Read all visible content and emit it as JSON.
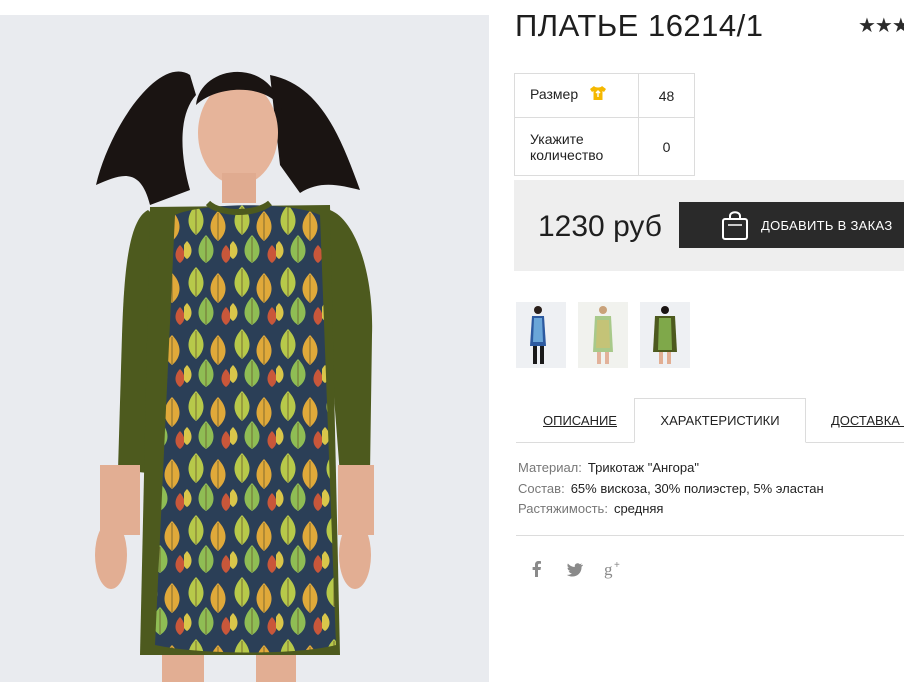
{
  "product": {
    "title": "ПЛАТЬЕ 16214/1",
    "rating_stars": "★★★"
  },
  "options": {
    "size_label": "Размер",
    "size_value": "48",
    "qty_label_line1": "Укажите",
    "qty_label_line2": "количество",
    "qty_value": "0"
  },
  "buy": {
    "price": "1230 руб",
    "add_button_label": "ДОБАВИТЬ В ЗАКАЗ"
  },
  "thumbnails": [
    "dress-thumb-1",
    "dress-thumb-2",
    "dress-thumb-3"
  ],
  "tabs": {
    "description": "ОПИСАНИЕ",
    "characteristics": "ХАРАКТЕРИСТИКИ",
    "delivery": "ДОСТАВКА И"
  },
  "specs": [
    {
      "key": "Материал:",
      "value": "Трикотаж \"Ангора\""
    },
    {
      "key": "Состав:",
      "value": "65% вискоза, 30% полиэстер, 5% эластан"
    },
    {
      "key": "Растяжимость:",
      "value": "средняя"
    }
  ],
  "social": [
    "facebook-icon",
    "twitter-icon",
    "google-plus-icon"
  ],
  "colors": {
    "dress_green": "#4d5a1e",
    "button_dark": "#2a2a2a",
    "size_icon": "#f5b800",
    "buybox_bg": "#eeeeee"
  }
}
